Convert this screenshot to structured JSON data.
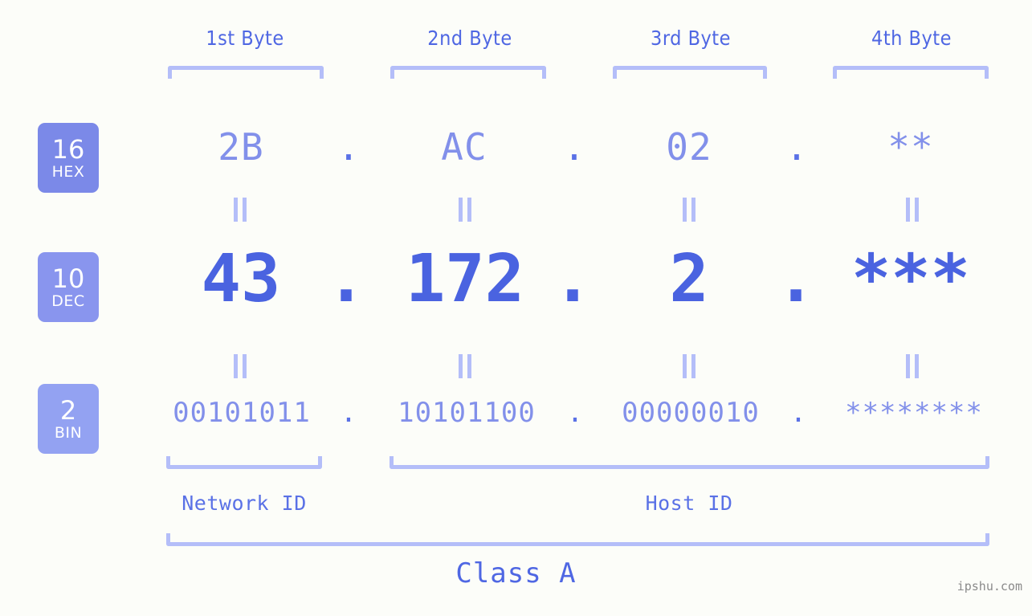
{
  "background_color": "#fcfdf9",
  "accent_colors": {
    "bracket": "#b4bef9",
    "header_text": "#4f67e3",
    "hex_text": "#8290ea",
    "dec_text": "#4a63e0",
    "bin_text": "#8290ea",
    "badge_hex": "#7b89e8",
    "badge_dec": "#8995ee",
    "badge_bin": "#93a2f2",
    "watermark": "#8a8a8a"
  },
  "byte_headers": [
    {
      "label": "1st Byte"
    },
    {
      "label": "2nd Byte"
    },
    {
      "label": "3rd Byte"
    },
    {
      "label": "4th Byte"
    }
  ],
  "bases": [
    {
      "number": "16",
      "abbr": "HEX"
    },
    {
      "number": "10",
      "abbr": "DEC"
    },
    {
      "number": "2",
      "abbr": "BIN"
    }
  ],
  "rows": {
    "hex": {
      "base_number": "16",
      "base_abbr": "HEX",
      "values": [
        "2B",
        "AC",
        "02",
        "**"
      ],
      "separator": "."
    },
    "dec": {
      "base_number": "10",
      "base_abbr": "DEC",
      "values": [
        "43",
        "172",
        "2",
        "***"
      ],
      "separator": "."
    },
    "bin": {
      "base_number": "2",
      "base_abbr": "BIN",
      "values": [
        "00101011",
        "10101100",
        "00000010",
        "********"
      ],
      "separator": "."
    }
  },
  "equivalence_symbol": "=",
  "id_sections": [
    {
      "label": "Network ID"
    },
    {
      "label": "Host ID"
    }
  ],
  "class_label": "Class A",
  "watermark": "ipshu.com"
}
